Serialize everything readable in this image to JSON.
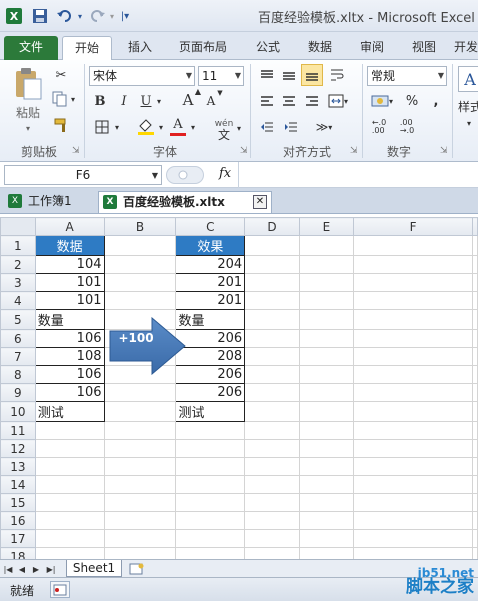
{
  "window": {
    "title": "百度经验模板.xltx - Microsoft Excel"
  },
  "ribbon": {
    "tabs": [
      "文件",
      "开始",
      "插入",
      "页面布局",
      "公式",
      "数据",
      "审阅",
      "视图",
      "开发"
    ],
    "active_tab": "开始",
    "clipboard": {
      "paste_label": "粘贴",
      "group_label": "剪贴板"
    },
    "font": {
      "name": "宋体",
      "size": "11",
      "bold": "B",
      "italic": "I",
      "underline": "U",
      "grow": "A",
      "shrink": "A",
      "font_color": "A",
      "phonetic": "wén",
      "group_label": "字体"
    },
    "alignment": {
      "group_label": "对齐方式"
    },
    "number": {
      "format": "常规",
      "group_label": "数字",
      "percent": "%",
      "comma": ","
    },
    "styles": {
      "label": "样式"
    }
  },
  "formula_bar": {
    "name_box": "F6",
    "fx": "fx",
    "content": ""
  },
  "workbook_tabs": [
    "工作簿1",
    "百度经验模板.xltx"
  ],
  "sheet": {
    "columns": [
      "A",
      "B",
      "C",
      "D",
      "E",
      "F"
    ],
    "rows": [
      "1",
      "2",
      "3",
      "4",
      "5",
      "6",
      "7",
      "8",
      "9",
      "10",
      "11",
      "12",
      "13",
      "14",
      "15",
      "16",
      "17",
      "18"
    ],
    "col_a": [
      "数据",
      "104",
      "101",
      "101",
      "数量",
      "106",
      "108",
      "106",
      "106",
      "测试"
    ],
    "col_c": [
      "效果",
      "204",
      "201",
      "201",
      "数量",
      "206",
      "208",
      "206",
      "206",
      "测试"
    ],
    "arrow_label": "+100"
  },
  "sheet_tabs": [
    "Sheet1"
  ],
  "status": {
    "mode": "就绪"
  },
  "watermark": {
    "line1": "jb51.net",
    "line2": "脚本之家"
  }
}
